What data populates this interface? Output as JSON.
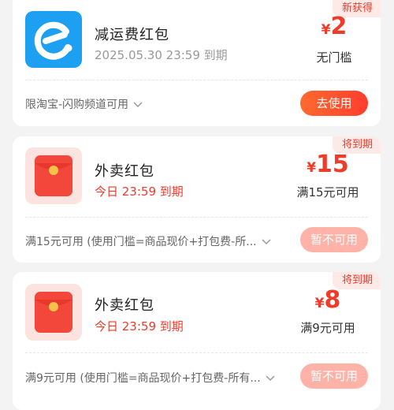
{
  "coupons": [
    {
      "tag": "新获得",
      "title": "减运费红包",
      "subtitle": "2025.05.30 23:59 到期",
      "currency": "¥",
      "amount": "2",
      "condition": "无门槛",
      "footer": "限淘宝-闪购频道可用",
      "button": "去使用",
      "icon": "eleme-logo-icon"
    },
    {
      "tag": "将到期",
      "title": "外卖红包",
      "subtitle": "今日 23:59 到期",
      "currency": "¥",
      "amount": "15",
      "condition": "满15元可用",
      "footer": "满15元可用 (使用门槛=商品现价+打包费-所...",
      "button": "暂不可用",
      "icon": "red-envelope-icon"
    },
    {
      "tag": "将到期",
      "title": "外卖红包",
      "subtitle": "今日 23:59 到期",
      "currency": "¥",
      "amount": "8",
      "condition": "满9元可用",
      "footer": "满9元可用 (使用门槛=商品现价+打包费-所有...",
      "button": "暂不可用",
      "icon": "red-envelope-icon"
    }
  ],
  "colors": {
    "accent": "#ef3b2a",
    "eleme_blue": "#1ea0f2",
    "disabled_button": "#ffb2a8"
  }
}
